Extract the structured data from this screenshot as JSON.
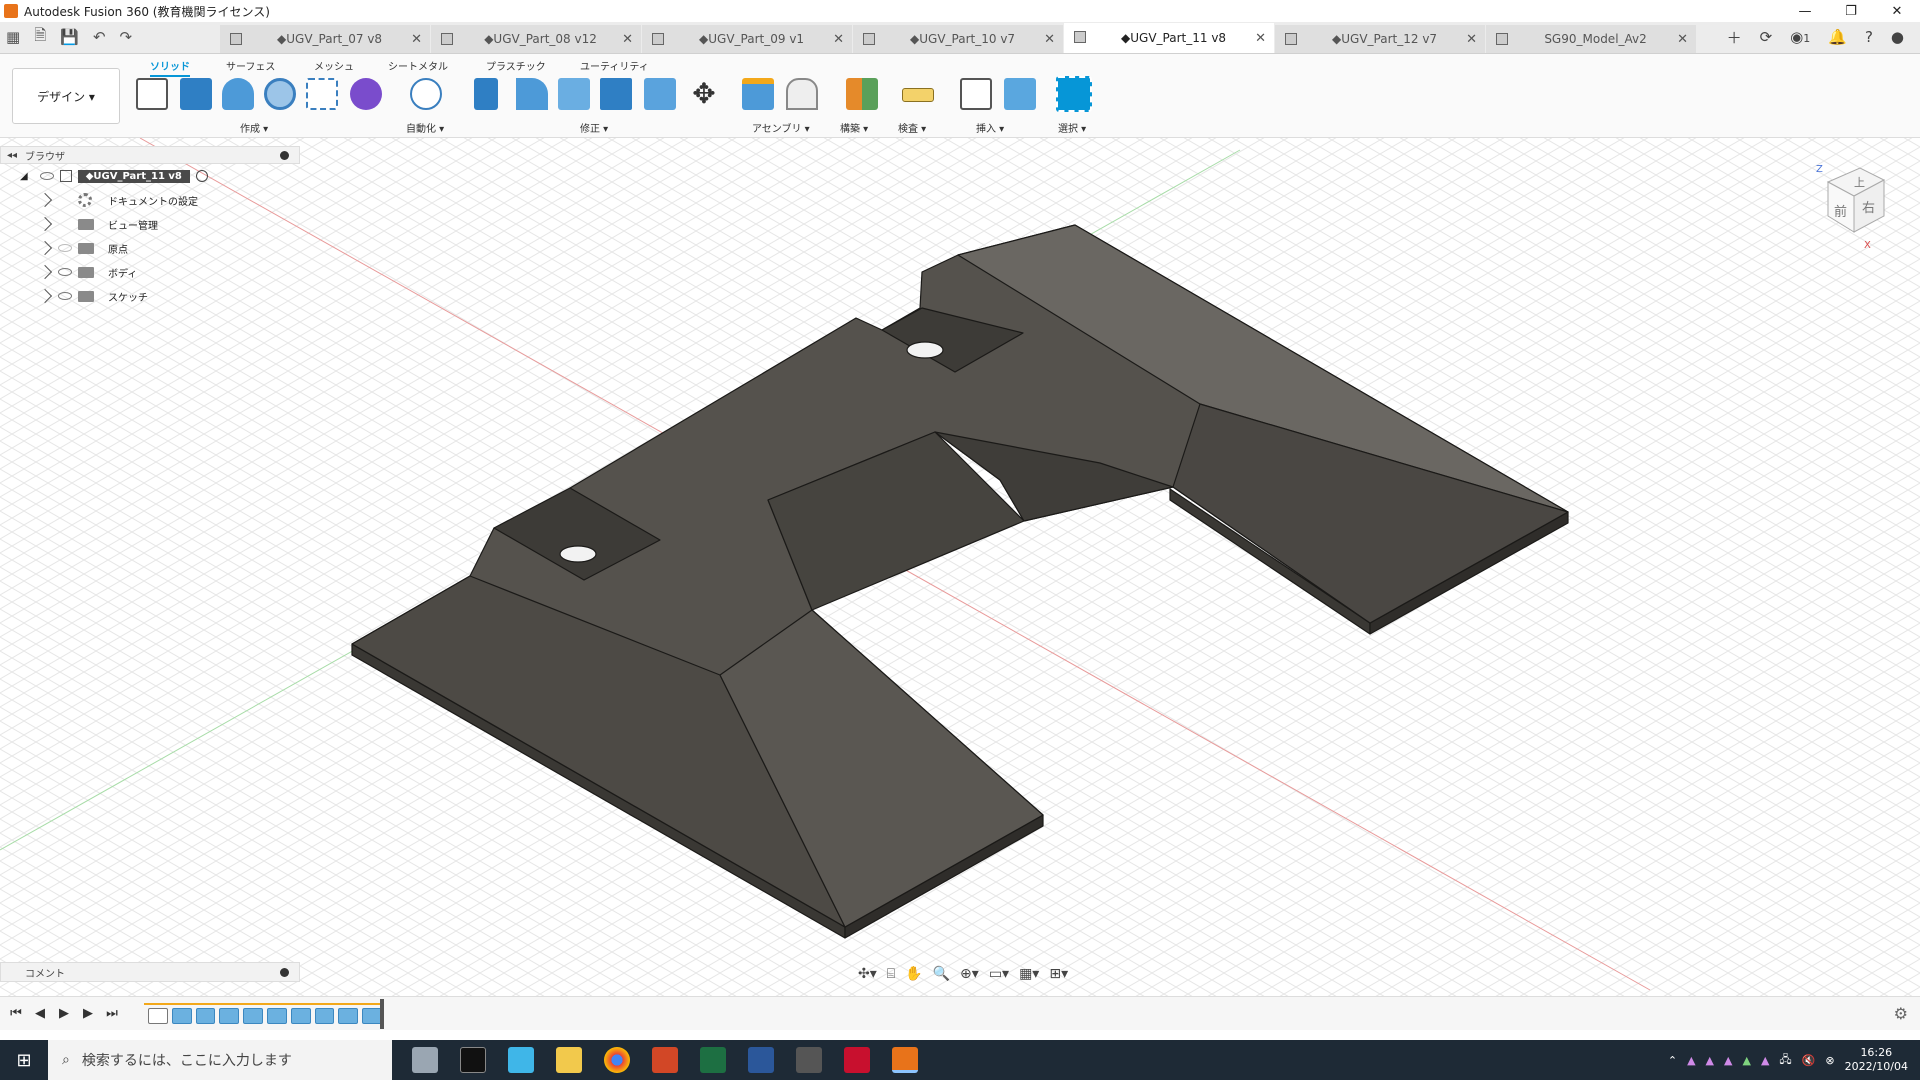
{
  "window": {
    "title": "Autodesk Fusion 360 (教育機関ライセンス)"
  },
  "tabs": [
    {
      "label": "◆UGV_Part_07 v8",
      "active": false
    },
    {
      "label": "◆UGV_Part_08 v12",
      "active": false
    },
    {
      "label": "◆UGV_Part_09 v1",
      "active": false
    },
    {
      "label": "◆UGV_Part_10 v7",
      "active": false
    },
    {
      "label": "◆UGV_Part_11 v8",
      "active": true
    },
    {
      "label": "◆UGV_Part_12 v7",
      "active": false
    },
    {
      "label": "SG90_Model_Av2",
      "active": false
    }
  ],
  "tab_extras": {
    "job_count": "1"
  },
  "ribbon": {
    "workspace": "デザイン ▾",
    "tabs": [
      "ソリッド",
      "サーフェス",
      "メッシュ",
      "シートメタル",
      "プラスチック",
      "ユーティリティ"
    ],
    "groups": [
      "作成 ▾",
      "自動化 ▾",
      "修正 ▾",
      "アセンブリ ▾",
      "構築 ▾",
      "検査 ▾",
      "挿入 ▾",
      "選択 ▾"
    ]
  },
  "browser": {
    "title": "ブラウザ",
    "root": "◆UGV_Part_11 v8",
    "items": [
      "ドキュメントの設定",
      "ビュー管理",
      "原点",
      "ボディ",
      "スケッチ"
    ]
  },
  "comments": {
    "title": "コメント"
  },
  "viewcube": {
    "top": "上",
    "front": "前",
    "right": "右",
    "axis_z": "Z",
    "axis_x": "X"
  },
  "taskbar": {
    "search_placeholder": "検索するには、ここに入力します",
    "time": "16:26",
    "date": "2022/10/04"
  },
  "colors": {
    "accent": "#0696d7",
    "model_top": "#55524d",
    "model_side": "#3a3834",
    "timeline": "#f3a81a"
  }
}
